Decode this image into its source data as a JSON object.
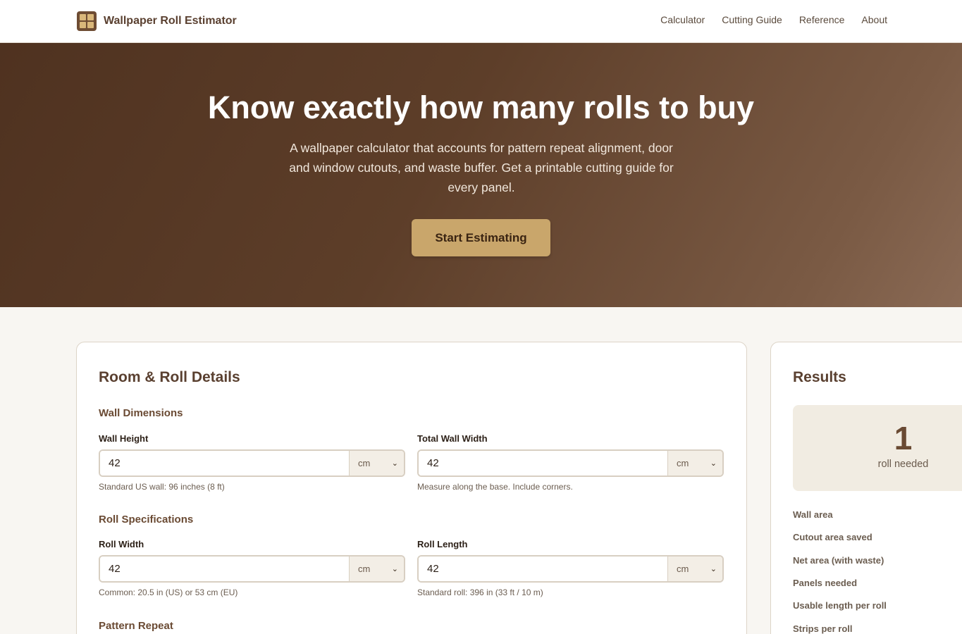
{
  "header": {
    "brand": "Wallpaper Roll Estimator",
    "nav": [
      "Calculator",
      "Cutting Guide",
      "Reference",
      "About"
    ]
  },
  "hero": {
    "title": "Know exactly how many rolls to buy",
    "subtitle": "A wallpaper calculator that accounts for pattern repeat alignment, door and window cutouts, and waste buffer. Get a printable cutting guide for every panel.",
    "cta": "Start Estimating"
  },
  "form": {
    "title": "Room & Roll Details",
    "wall_section": "Wall Dimensions",
    "wall_height": {
      "label": "Wall Height",
      "value": "42",
      "unit": "cm",
      "hint": "Standard US wall: 96 inches (8 ft)"
    },
    "wall_width": {
      "label": "Total Wall Width",
      "value": "42",
      "unit": "cm",
      "hint": "Measure along the base. Include corners."
    },
    "roll_section": "Roll Specifications",
    "roll_width": {
      "label": "Roll Width",
      "value": "42",
      "unit": "cm",
      "hint": "Common: 20.5 in (US) or 53 cm (EU)"
    },
    "roll_length": {
      "label": "Roll Length",
      "value": "42",
      "unit": "cm",
      "hint": "Standard roll: 396 in (33 ft / 10 m)"
    },
    "pattern_section": "Pattern Repeat"
  },
  "results": {
    "title": "Results",
    "rolls": "1",
    "rolls_label": "roll needed",
    "rows": [
      "Wall area",
      "Cutout area saved",
      "Net area (with waste)",
      "Panels needed",
      "Usable length per roll",
      "Strips per roll"
    ]
  },
  "icons": {
    "logo": "grid-logo-icon",
    "unit_select": "chevron-down-icon"
  },
  "colors": {
    "brand": "#6e4c33",
    "accent": "#c9a66b",
    "hero_start": "#4f3220",
    "hero_end": "#8a6a55"
  }
}
